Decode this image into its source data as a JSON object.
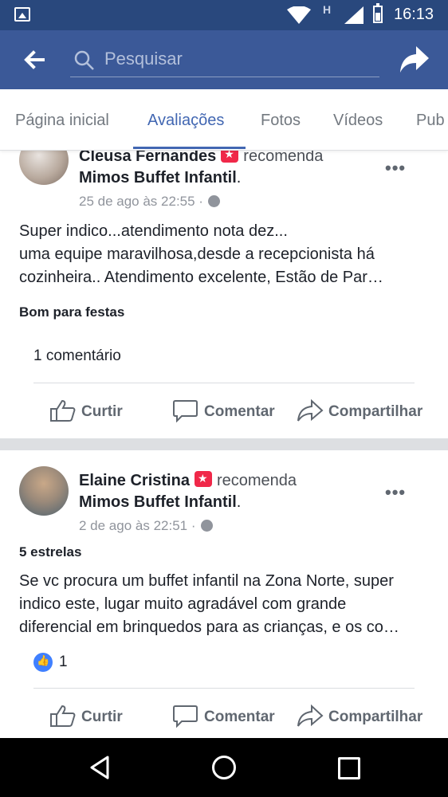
{
  "status_bar": {
    "time": "16:13",
    "network_label": "H"
  },
  "header": {
    "search_placeholder": "Pesquisar",
    "icons": [
      "back-arrow-icon",
      "search-icon",
      "share-icon"
    ]
  },
  "tabs": [
    {
      "label": "Página inicial",
      "active": false
    },
    {
      "label": "Avaliações",
      "active": true
    },
    {
      "label": "Fotos",
      "active": false
    },
    {
      "label": "Vídeos",
      "active": false
    },
    {
      "label": "Pub",
      "active": false
    }
  ],
  "posts": [
    {
      "author": "Cleusa Fernandes",
      "action": "recomenda",
      "page": "Mimos Buffet Infantil",
      "page_suffix": ".",
      "timestamp": "25 de ago às 22:55 ·",
      "text_lines": [
        "Super indico...atendimento nota dez...",
        "uma equipe maravilhosa,desde a recepcionista há",
        "cozinheira.. Atendimento excelente, Estão de Par…"
      ],
      "tag": "Bom para festas",
      "comments": "1 comentário",
      "actions": {
        "like": "Curtir",
        "comment": "Comentar",
        "share": "Compartilhar"
      }
    },
    {
      "author": "Elaine Cristina",
      "action": "recomenda",
      "page": "Mimos Buffet Infantil",
      "page_suffix": ".",
      "timestamp": "2 de ago às 22:51 ·",
      "tag": "5 estrelas",
      "text_lines": [
        "Se vc procura um buffet infantil na Zona Norte, super",
        "indico este, lugar muito agradável com grande",
        "diferencial em brinquedos para as crianças, e os co…"
      ],
      "reactions": "1",
      "actions": {
        "like": "Curtir",
        "comment": "Comentar",
        "share": "Compartilhar"
      }
    }
  ],
  "colors": {
    "status_bar": "#29487d",
    "header": "#3b5998",
    "accent": "#4267b2",
    "badge": "#f02849"
  }
}
